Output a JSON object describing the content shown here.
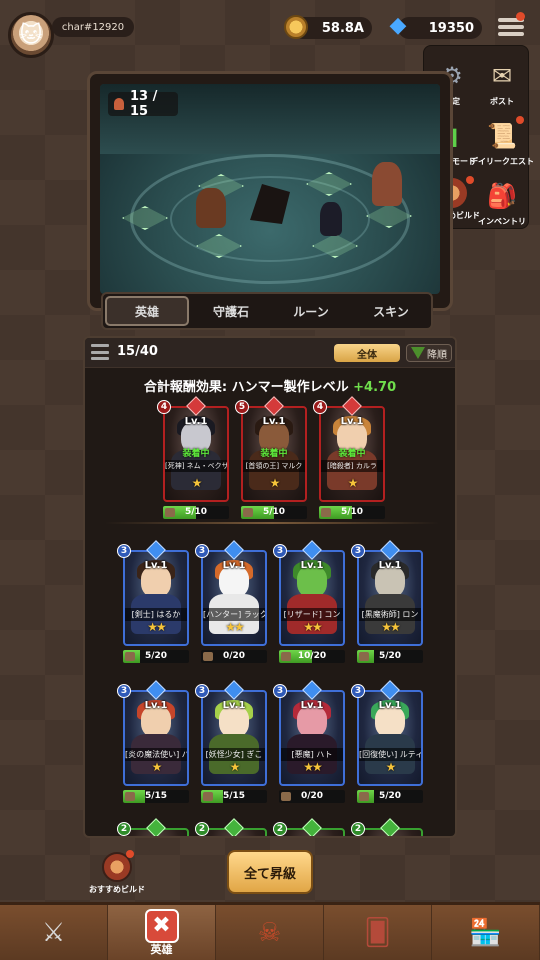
{
  "player": {
    "name": "char#12920"
  },
  "resources": {
    "gold": "58.8A",
    "gems": "19350"
  },
  "side_menu": [
    {
      "label": "設定",
      "icon": "gear-icon",
      "badge": false
    },
    {
      "label": "ポスト",
      "icon": "mail-icon",
      "badge": false
    },
    {
      "label": "省エネモード",
      "icon": "battery-icon",
      "badge": false
    },
    {
      "label": "デイリークエスト",
      "icon": "scroll-icon",
      "badge": true
    },
    {
      "label": "おすすめビルド",
      "icon": "build-icon",
      "badge": true
    },
    {
      "label": "インベントリ",
      "icon": "backpack-icon",
      "badge": false
    }
  ],
  "battle": {
    "wave": "13 / 15"
  },
  "tabs": [
    "英雄",
    "守護石",
    "ルーン",
    "スキン"
  ],
  "hero_panel": {
    "count": "15/40",
    "filter_label": "全体",
    "sort_label": "降順",
    "bonus_label": "合計報酬効果: ハンマー製作レベル",
    "bonus_value": "+4.70"
  },
  "equipped_heroes": [
    {
      "grade": "4",
      "lv": "Lv.1",
      "status": "装着中",
      "name": "[死神] ネム・ベクサ",
      "stars": "★",
      "progress": "5/10",
      "fill": 0.5,
      "skin": "#c8c8cf",
      "hair": "#1a1a22",
      "body": "#2b2b36"
    },
    {
      "grade": "5",
      "lv": "Lv.1",
      "status": "装着中",
      "name": "[首領の王] マルク",
      "stars": "★",
      "progress": "5/10",
      "fill": 0.5,
      "skin": "#8a5a3a",
      "hair": "#2a1a12",
      "body": "#4a2a1a"
    },
    {
      "grade": "4",
      "lv": "Lv.1",
      "status": "装着中",
      "name": "[暗殺者] カルラ",
      "stars": "★",
      "progress": "5/10",
      "fill": 0.5,
      "skin": "#f0cfae",
      "hair": "#c9843a",
      "body": "#7a3a2a"
    }
  ],
  "heroes": [
    {
      "grade": "3",
      "lv": "Lv.1",
      "name": "[剣士] はるか",
      "stars": "★★",
      "progress": "5/20",
      "fill": 0.25,
      "skin": "#f0cfae",
      "hair": "#3a2418",
      "body": "#2b3a6a"
    },
    {
      "grade": "3",
      "lv": "Lv.1",
      "name": "[ハンター] ラック",
      "stars": "★★",
      "progress": "0/20",
      "fill": 0.0,
      "skin": "#f5f5f5",
      "hair": "#d56a2a",
      "body": "#e8e8e8"
    },
    {
      "grade": "3",
      "lv": "Lv.1",
      "name": "[リザード] コン",
      "stars": "★★",
      "progress": "10/20",
      "fill": 0.5,
      "skin": "#6cbf4a",
      "hair": "#3e8a2a",
      "body": "#a02a2a"
    },
    {
      "grade": "3",
      "lv": "Lv.1",
      "name": "[黒魔術師] ロン",
      "stars": "★★",
      "progress": "5/20",
      "fill": 0.25,
      "skin": "#c9c3b4",
      "hair": "#2a2a2a",
      "body": "#3a3a3a"
    },
    {
      "grade": "3",
      "lv": "Lv.1",
      "name": "[炎の魔法使い] バイオ",
      "stars": "★",
      "progress": "5/15",
      "fill": 0.33,
      "skin": "#f0cfae",
      "hair": "#c6452a",
      "body": "#3a2a3a"
    },
    {
      "grade": "3",
      "lv": "Lv.1",
      "name": "[妖怪少女] ぎこ",
      "stars": "★",
      "progress": "5/15",
      "fill": 0.33,
      "skin": "#f5e0c6",
      "hair": "#a6d04a",
      "body": "#4a6a2a"
    },
    {
      "grade": "3",
      "lv": "Lv.1",
      "name": "[悪魔] ハト",
      "stars": "★★",
      "progress": "0/20",
      "fill": 0.0,
      "skin": "#e69aa6",
      "hair": "#b52a3a",
      "body": "#2a1a2a"
    },
    {
      "grade": "3",
      "lv": "Lv.1",
      "name": "[回復使い] ルティ",
      "stars": "★",
      "progress": "5/20",
      "fill": 0.25,
      "skin": "#f5e0c6",
      "hair": "#3aa85a",
      "body": "#2a3a4a"
    },
    {
      "grade": "2",
      "lv": "",
      "name": "",
      "stars": "",
      "progress": "",
      "fill": 0,
      "skin": "#f0cfae",
      "hair": "#3a2418",
      "body": "#2b3a2a"
    },
    {
      "grade": "2",
      "lv": "",
      "name": "",
      "stars": "",
      "progress": "",
      "fill": 0,
      "skin": "#f0cfae",
      "hair": "#3a2418",
      "body": "#2b3a2a"
    },
    {
      "grade": "2",
      "lv": "",
      "name": "",
      "stars": "",
      "progress": "",
      "fill": 0,
      "skin": "#f0cfae",
      "hair": "#3a2418",
      "body": "#2b3a2a"
    },
    {
      "grade": "2",
      "lv": "",
      "name": "",
      "stars": "",
      "progress": "",
      "fill": 0,
      "skin": "#f0cfae",
      "hair": "#3a2418",
      "body": "#2b3a2a"
    }
  ],
  "bottom": {
    "recommended_build": "おすすめビルド",
    "upgrade_all": "全て昇級"
  },
  "nav": [
    {
      "label": "",
      "icon": "crossed-swords-icon"
    },
    {
      "label": "英雄",
      "icon": "hero-icon",
      "active": true
    },
    {
      "label": "",
      "icon": "demon-skull-icon"
    },
    {
      "label": "",
      "icon": "cards-icon"
    },
    {
      "label": "",
      "icon": "shop-icon"
    }
  ]
}
